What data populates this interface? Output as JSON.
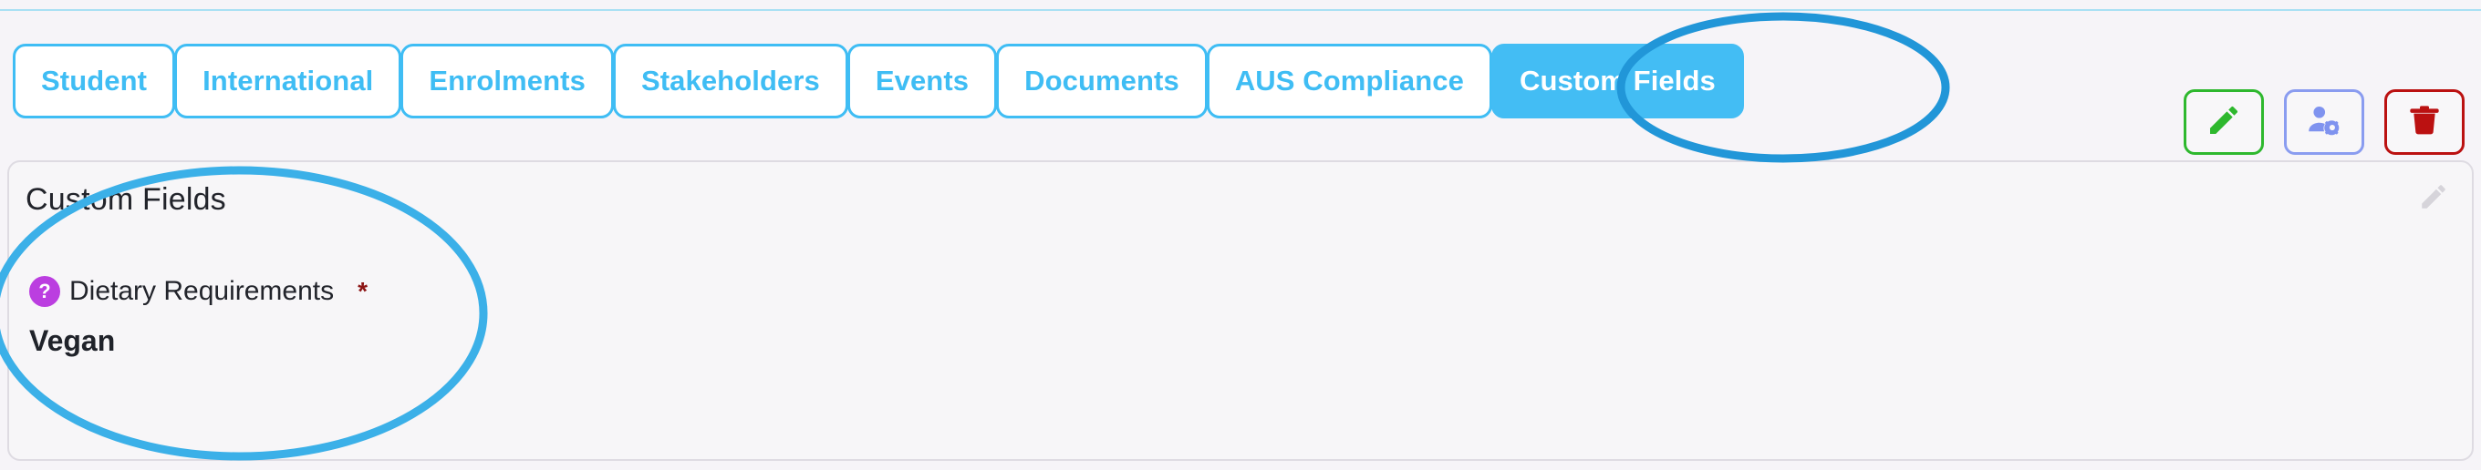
{
  "tabs": [
    {
      "label": "Student",
      "active": false
    },
    {
      "label": "International",
      "active": false
    },
    {
      "label": "Enrolments",
      "active": false
    },
    {
      "label": "Stakeholders",
      "active": false
    },
    {
      "label": "Events",
      "active": false
    },
    {
      "label": "Documents",
      "active": false
    },
    {
      "label": "AUS Compliance",
      "active": false
    },
    {
      "label": "Custom Fields",
      "active": true
    }
  ],
  "toolbar": {
    "edit_label": "",
    "user_settings_label": "",
    "delete_label": ""
  },
  "panel": {
    "title": "Custom Fields",
    "fields": [
      {
        "help": "?",
        "label": "Dietary Requirements",
        "required_marker": "*",
        "value": "Vegan"
      }
    ]
  },
  "annotations": {
    "tab_highlight_shape": "ellipse",
    "content_highlight_shape": "ellipse",
    "stroke_color": "#2196d8"
  },
  "colors": {
    "accent_blue": "#3fbdf4",
    "active_tab_bg": "#43bdf4",
    "page_bg": "#f6f4f8",
    "panel_bg": "#f7f6f8",
    "panel_border": "#dedbe2",
    "help_badge_purple": "#bb3ee0",
    "required_red": "#8c1414",
    "edit_green": "#2eb82e",
    "user_blue": "#8a9cf0",
    "delete_red": "#bb1111",
    "annotation_blue": "#2196d8"
  }
}
